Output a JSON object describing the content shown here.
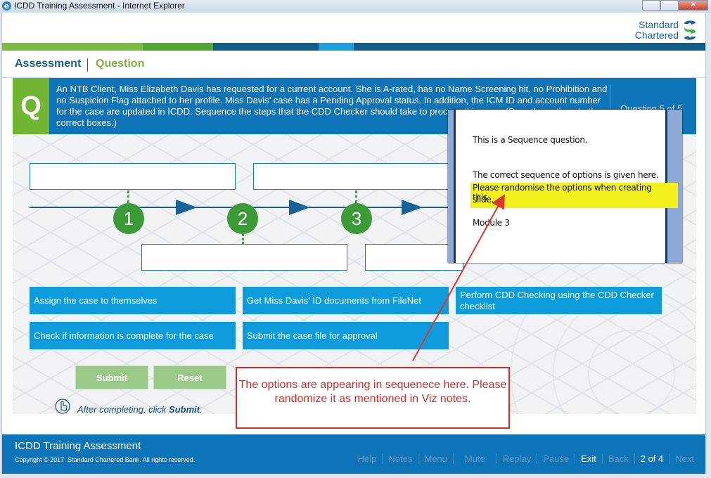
{
  "window": {
    "title": "ICDD Training Assessment - Internet Explorer",
    "close_label": "✕"
  },
  "logo": {
    "line1": "Standard",
    "line2": "Chartered"
  },
  "header": {
    "assessment": "Assessment",
    "question": "Question"
  },
  "question": {
    "badge": "Q",
    "text": "An NTB Client, Miss Elizabeth Davis has requested for a current account. She is A-rated, has no Name Screening hit, no Prohibition and no Suspicion Flag attached to her profile. Miss Davis’ case has a Pending Approval status. In addition, the ICM ID and account number for the case are updated in ICDD. Sequence the steps that the CDD Checker should take to process this case. (Drag the options to the correct boxes.)",
    "number": "Question 5 of 5"
  },
  "steps": [
    "1",
    "2",
    "3"
  ],
  "options": [
    "Assign the case to themselves",
    "Get Miss Davis’ ID documents from FileNet",
    "Perform CDD Checking using the CDD Checker checklist",
    "Check if information is complete for the case",
    "Submit the case file for approval"
  ],
  "buttons": {
    "submit": "Submit",
    "reset": "Reset"
  },
  "hint": {
    "prefix": "After completing, click ",
    "action": "Submit",
    "suffix": "."
  },
  "footer": {
    "title": "ICDD Training Assessment",
    "copyright": "Copyright © 2017. Standard Chartered Bank. All rights reserved.",
    "nav": {
      "help": "Help",
      "notes": "Notes",
      "menu": "Menu",
      "mute": "Mute",
      "replay": "Replay",
      "pause": "Pause",
      "exit": "Exit",
      "back": "Back",
      "page": "2 of 4",
      "next": "Next"
    }
  },
  "notes_popup": {
    "line1": "This is a Sequence question.",
    "line2": "The correct sequence of options is given here.",
    "line3": "Please randomise the options when creating this",
    "line4": "slide.",
    "line5": "Module 3"
  },
  "review_comment": {
    "text": "The options are appearing in sequenece here. Please randomize it as mentioned in Viz notes."
  },
  "colors": {
    "brand_blue": "#0d74b8",
    "brand_green": "#72b533",
    "option_blue": "#0d9bdc",
    "step_green": "#3c9b36",
    "annotation_red": "#d42a2a",
    "highlight_yellow": "#f3f21e"
  },
  "icons": [
    "ie-icon",
    "standard-chartered-logo-icon",
    "hand-pointer-icon",
    "arrow-icon"
  ]
}
